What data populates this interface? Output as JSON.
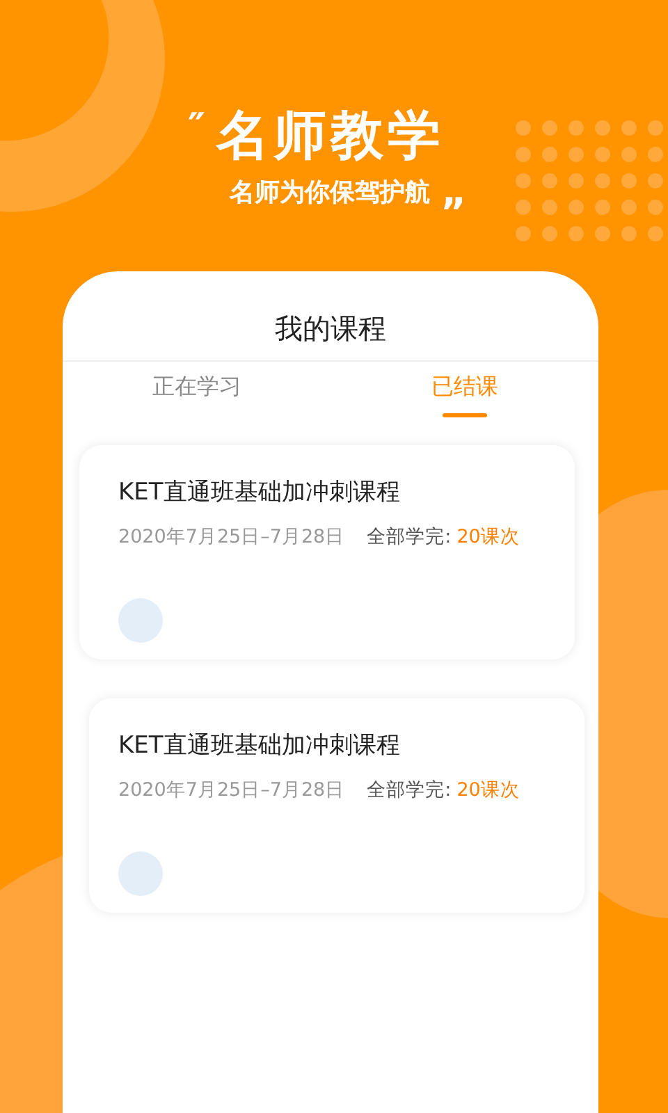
{
  "hero": {
    "open_quote": "″",
    "title": "名师教学",
    "subtitle": "名师为你保驾护航",
    "close_quote": "„"
  },
  "panel": {
    "title": "我的课程"
  },
  "tabs": [
    {
      "label": "正在学习",
      "selected": false
    },
    {
      "label": "已结课",
      "selected": true
    }
  ],
  "courses": [
    {
      "title": "KET直通班基础加冲刺课程",
      "dates": "2020年7月25日–7月28日",
      "total_label": "全部学完:",
      "total_value": "20课次"
    },
    {
      "title": "KET直通班基础加冲刺课程",
      "dates": "2020年7月25日–7月28日",
      "total_label": "全部学完:",
      "total_value": "20课次"
    }
  ]
}
